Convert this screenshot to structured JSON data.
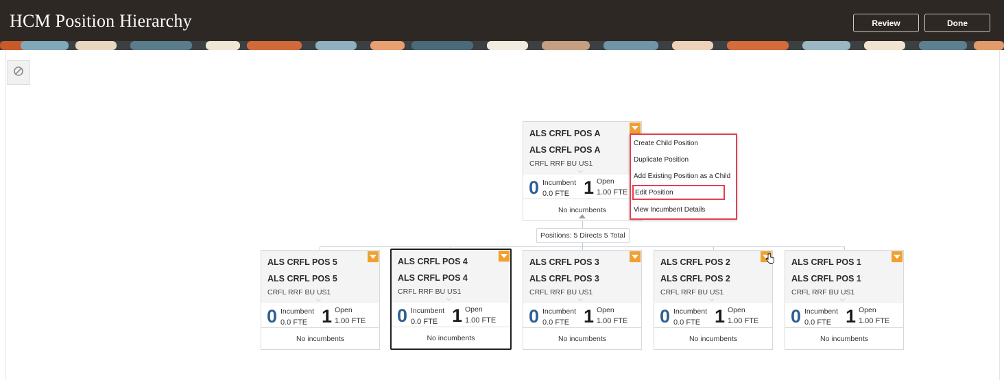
{
  "header": {
    "title": "HCM Position Hierarchy",
    "review_label": "Review",
    "done_label": "Done"
  },
  "canvas": {
    "reset_icon": "no-entry-icon"
  },
  "root": {
    "title": "ALS CRFL POS A",
    "name": "ALS CRFL POS A",
    "business_unit": "CRFL RRF BU US1",
    "incumbent_count": "0",
    "incumbent_label": "Incumbent",
    "incumbent_fte": "0.0 FTE",
    "open_count": "1",
    "open_label": "Open",
    "open_fte": "1.00 FTE",
    "footer": "No incumbents"
  },
  "positions_summary": "Positions: 5 Directs 5 Total",
  "context_menu": {
    "items": [
      "Create Child Position",
      "Duplicate Position",
      "Add Existing Position as a Child",
      "Edit Position",
      "View Incumbent Details"
    ],
    "highlighted": "Edit Position",
    "accent_color": "#e04050"
  },
  "children": [
    {
      "title": "ALS CRFL POS 5",
      "name": "ALS CRFL POS 5",
      "business_unit": "CRFL RRF BU US1",
      "incumbent_count": "0",
      "incumbent_label": "Incumbent",
      "incumbent_fte": "0.0 FTE",
      "open_count": "1",
      "open_label": "Open",
      "open_fte": "1.00 FTE",
      "footer": "No incumbents"
    },
    {
      "title": "ALS CRFL POS 4",
      "name": "ALS CRFL POS 4",
      "business_unit": "CRFL RRF BU US1",
      "incumbent_count": "0",
      "incumbent_label": "Incumbent",
      "incumbent_fte": "0.0 FTE",
      "open_count": "1",
      "open_label": "Open",
      "open_fte": "1.00 FTE",
      "footer": "No incumbents"
    },
    {
      "title": "ALS CRFL POS 3",
      "name": "ALS CRFL POS 3",
      "business_unit": "CRFL RRF BU US1",
      "incumbent_count": "0",
      "incumbent_label": "Incumbent",
      "incumbent_fte": "0.0 FTE",
      "open_count": "1",
      "open_label": "Open",
      "open_fte": "1.00 FTE",
      "footer": "No incumbents"
    },
    {
      "title": "ALS CRFL POS 2",
      "name": "ALS CRFL POS 2",
      "business_unit": "CRFL RRF BU US1",
      "incumbent_count": "0",
      "incumbent_label": "Incumbent",
      "incumbent_fte": "0.0 FTE",
      "open_count": "1",
      "open_label": "Open",
      "open_fte": "1.00 FTE",
      "footer": "No incumbents"
    },
    {
      "title": "ALS CRFL POS 1",
      "name": "ALS CRFL POS 1",
      "business_unit": "CRFL RRF BU US1",
      "incumbent_count": "0",
      "incumbent_label": "Incumbent",
      "incumbent_fte": "0.0 FTE",
      "open_count": "1",
      "open_label": "Open",
      "open_fte": "1.00 FTE",
      "footer": "No incumbents"
    }
  ],
  "selected_child": "ALS CRFL POS 4",
  "colors": {
    "header_bg": "#2e2825",
    "menu_button": "#f0a030",
    "incumbent_number": "#2d5f94"
  }
}
